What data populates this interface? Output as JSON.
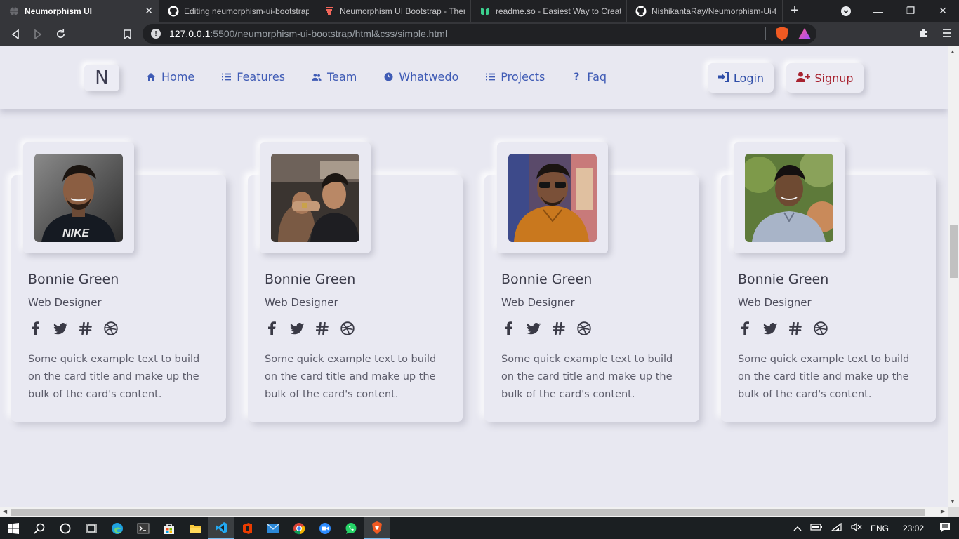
{
  "browser": {
    "tabs": [
      {
        "title": "Neumorphism UI",
        "icon": "globe-icon",
        "active": true
      },
      {
        "title": "Editing neumorphism-ui-bootstrap",
        "icon": "github-icon",
        "active": false
      },
      {
        "title": "Neumorphism UI Bootstrap - Them",
        "icon": "themesberg-icon",
        "active": false
      },
      {
        "title": "readme.so - Easiest Way to Create",
        "icon": "readme-icon",
        "active": false
      },
      {
        "title": "NishikantaRay/Neumorphism-Ui-te",
        "icon": "github-icon",
        "active": false
      }
    ],
    "url_host": "127.0.0.1",
    "url_path": ":5500/neumorphism-ui-bootstrap/html&css/simple.html"
  },
  "navbar": {
    "brand": "N",
    "links": [
      {
        "label": "Home",
        "icon": "home-icon"
      },
      {
        "label": "Features",
        "icon": "list-icon"
      },
      {
        "label": "Team",
        "icon": "users-icon"
      },
      {
        "label": "Whatwedo",
        "icon": "compass-icon"
      },
      {
        "label": "Projects",
        "icon": "list-icon"
      },
      {
        "label": "Faq",
        "icon": "question-icon"
      }
    ],
    "login": "Login",
    "signup": "Signup"
  },
  "cards": [
    {
      "name": "Bonnie Green",
      "role": "Web Designer",
      "text": "Some quick example text to build on the card title and make up the bulk of the card's content."
    },
    {
      "name": "Bonnie Green",
      "role": "Web Designer",
      "text": "Some quick example text to build on the card title and make up the bulk of the card's content."
    },
    {
      "name": "Bonnie Green",
      "role": "Web Designer",
      "text": "Some quick example text to build on the card title and make up the bulk of the card's content."
    },
    {
      "name": "Bonnie Green",
      "role": "Web Designer",
      "text": "Some quick example text to build on the card title and make up the bulk of the card's content."
    }
  ],
  "socials": [
    "facebook-icon",
    "twitter-icon",
    "slack-icon",
    "dribbble-icon"
  ],
  "taskbar": {
    "language": "ENG",
    "time": "23:02"
  },
  "colors": {
    "nav_link": "#3f5bb5",
    "login": "#2f4ea8",
    "signup": "#a8222f",
    "background": "#e8e8f1"
  }
}
